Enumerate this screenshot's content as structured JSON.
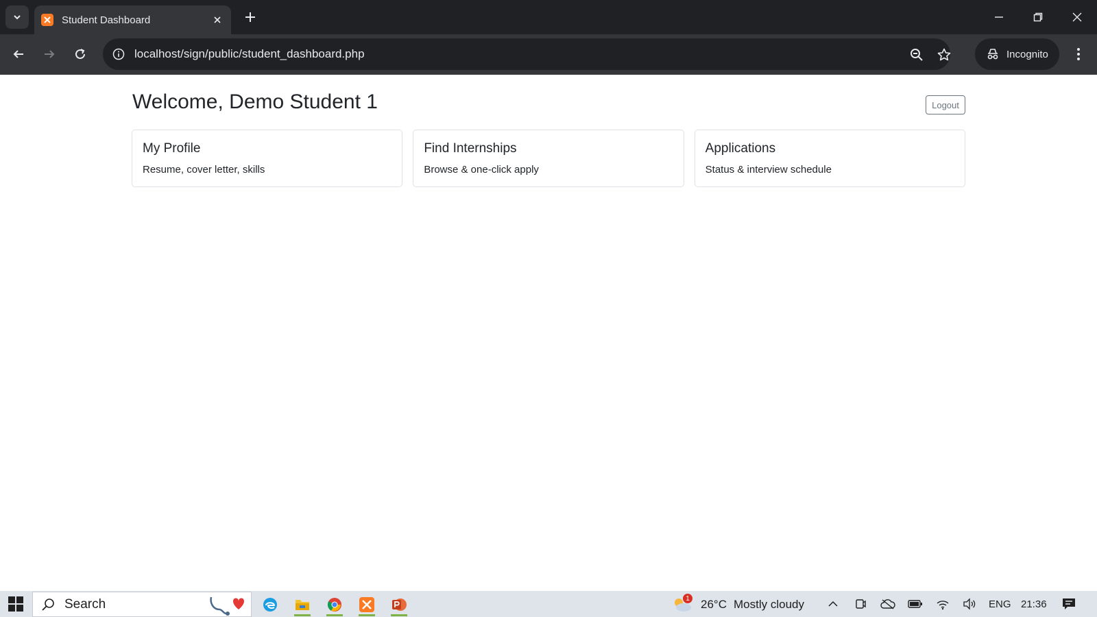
{
  "browser": {
    "tab_title": "Student Dashboard",
    "url": "localhost/sign/public/student_dashboard.php",
    "incognito_label": "Incognito"
  },
  "page": {
    "welcome": "Welcome, Demo Student 1",
    "logout_label": "Logout",
    "cards": [
      {
        "title": "My Profile",
        "subtitle": "Resume, cover letter, skills"
      },
      {
        "title": "Find Internships",
        "subtitle": "Browse & one-click apply"
      },
      {
        "title": "Applications",
        "subtitle": "Status & interview schedule"
      }
    ]
  },
  "taskbar": {
    "search_placeholder": "Search",
    "weather_temp": "26°C",
    "weather_desc": "Mostly cloudy",
    "weather_badge": "1",
    "language": "ENG",
    "time": "21:36",
    "apps": [
      "edge-icon",
      "file-explorer-icon",
      "chrome-icon",
      "xampp-icon",
      "powerpoint-icon"
    ]
  },
  "colors": {
    "chrome_dark": "#202124",
    "chrome_mid": "#35363a",
    "xampp_orange": "#fb7a24",
    "taskbar_bg": "#dfe4ea"
  }
}
